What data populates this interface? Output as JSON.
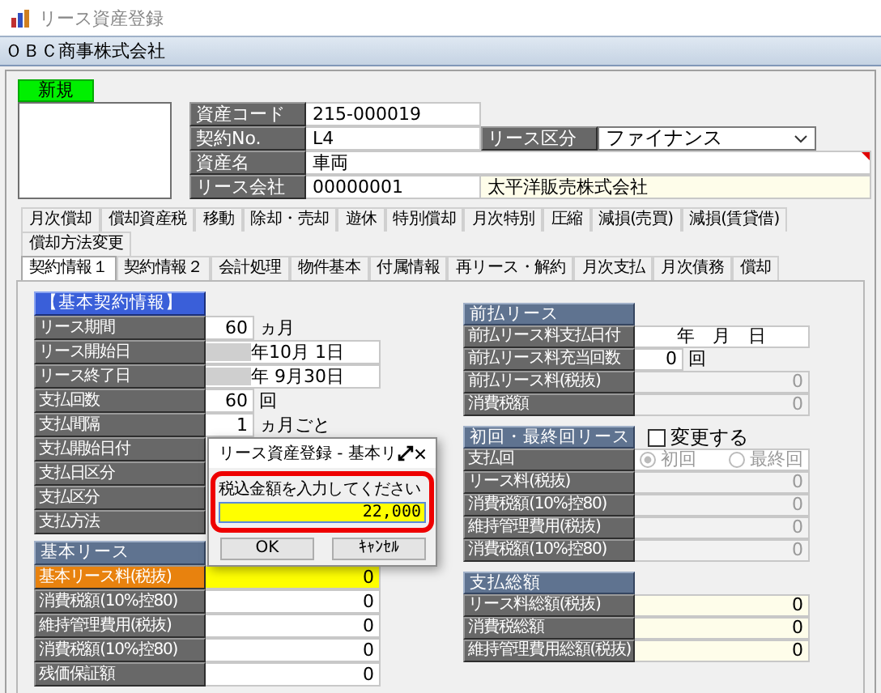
{
  "window": {
    "title": "リース資産登録"
  },
  "company": "ＯＢＣ商事株式会社",
  "mode_badge": "新規",
  "header_rows": [
    [
      {
        "label": "資産コード",
        "value": "215-000019",
        "kind": "text"
      }
    ],
    [
      {
        "label": "契約No.",
        "value": "L4",
        "kind": "text"
      },
      {
        "label": "リース区分",
        "value": "ファイナンス",
        "kind": "select"
      }
    ],
    [
      {
        "label": "資産名",
        "value": "車両",
        "kind": "wide",
        "required": true
      }
    ],
    [
      {
        "label": "リース会社",
        "value": "00000001",
        "kind": "text"
      },
      {
        "value": "太平洋販売株式会社",
        "kind": "name"
      }
    ]
  ],
  "tab_rows": [
    [
      {
        "label": "月次償却",
        "selected": false
      },
      {
        "label": "償却資産税",
        "selected": false
      },
      {
        "label": "移動",
        "selected": false
      },
      {
        "label": "除却・売却",
        "selected": false
      },
      {
        "label": "遊休",
        "selected": false
      },
      {
        "label": "特別償却",
        "selected": false
      },
      {
        "label": "月次特別",
        "selected": false
      },
      {
        "label": "圧縮",
        "selected": false
      },
      {
        "label": "減損(売買)",
        "selected": false
      },
      {
        "label": "減損(賃貸借)",
        "selected": false
      }
    ],
    [
      {
        "label": "償却方法変更",
        "selected": false
      }
    ],
    [
      {
        "label": "契約情報１",
        "selected": true
      },
      {
        "label": "契約情報２",
        "selected": false
      },
      {
        "label": "会計処理",
        "selected": false
      },
      {
        "label": "物件基本",
        "selected": false
      },
      {
        "label": "付属情報",
        "selected": false
      },
      {
        "label": "再リース・解約",
        "selected": false
      },
      {
        "label": "月次支払",
        "selected": false
      },
      {
        "label": "月次債務",
        "selected": false
      },
      {
        "label": "償却",
        "selected": false
      }
    ]
  ],
  "left_sections": [
    {
      "title": "【基本契約情報】",
      "kind": "primary",
      "rows": [
        {
          "label": "リース期間",
          "kind": "count",
          "value": "60",
          "unit": "ヵ月"
        },
        {
          "label": "リース開始日",
          "kind": "date",
          "masked": true,
          "value": "年10月 1日"
        },
        {
          "label": "リース終了日",
          "kind": "date",
          "masked": true,
          "value": "年 9月30日"
        },
        {
          "label": "支払回数",
          "kind": "count",
          "value": "60",
          "unit": "回"
        },
        {
          "label": "支払間隔",
          "kind": "count",
          "value": "1",
          "unit": "ヵ月ごと"
        },
        {
          "label": "支払開始日付",
          "kind": "blank"
        },
        {
          "label": "支払日区分",
          "kind": "blank"
        },
        {
          "label": "支払区分",
          "kind": "blank"
        },
        {
          "label": "支払方法",
          "kind": "blank"
        }
      ]
    },
    {
      "title": "基本リース",
      "kind": "secondary",
      "rows": [
        {
          "label": "基本リース料(税抜)",
          "kind": "amount",
          "value": "0",
          "focused": true,
          "disabled": false,
          "readonly": false
        },
        {
          "label": "消費税額(10%控80)",
          "kind": "amount",
          "value": "0",
          "focused": false,
          "disabled": false,
          "readonly": false
        },
        {
          "label": "維持管理費用(税抜)",
          "kind": "amount",
          "value": "0",
          "focused": false,
          "disabled": false,
          "readonly": false
        },
        {
          "label": "消費税額(10%控80)",
          "kind": "amount",
          "value": "0",
          "focused": false,
          "disabled": false,
          "readonly": false
        },
        {
          "label": "残価保証額",
          "kind": "amount",
          "value": "0",
          "focused": false,
          "disabled": false,
          "readonly": false
        }
      ]
    }
  ],
  "right_sections": [
    {
      "title": "前払リース",
      "kind": "secondary",
      "rows": [
        {
          "label": "前払リース料支払日付",
          "kind": "date",
          "value": "年　月　日"
        },
        {
          "label": "前払リース料充当回数",
          "kind": "count",
          "value": "0",
          "unit": "回"
        },
        {
          "label": "前払リース料(税抜)",
          "kind": "amount",
          "value": "0",
          "focused": false,
          "disabled": true,
          "readonly": false
        },
        {
          "label": "消費税額",
          "kind": "amount",
          "value": "0",
          "focused": false,
          "disabled": true,
          "readonly": false
        }
      ]
    },
    {
      "title": "初回・最終回リース",
      "kind": "secondary",
      "checkbox": {
        "label": "変更する",
        "checked": false
      },
      "rows": [
        {
          "label": "支払回",
          "kind": "radio",
          "disabled": true,
          "options": [
            {
              "label": "初回",
              "selected": true
            },
            {
              "label": "最終回",
              "selected": false
            }
          ]
        },
        {
          "label": "リース料(税抜)",
          "kind": "amount",
          "value": "0",
          "focused": false,
          "disabled": true,
          "readonly": false
        },
        {
          "label": "消費税額(10%控80)",
          "kind": "amount",
          "value": "0",
          "focused": false,
          "disabled": true,
          "readonly": false
        },
        {
          "label": "維持管理費用(税抜)",
          "kind": "amount",
          "value": "0",
          "focused": false,
          "disabled": true,
          "readonly": false
        },
        {
          "label": "消費税額(10%控80)",
          "kind": "amount",
          "value": "0",
          "focused": false,
          "disabled": true,
          "readonly": false
        }
      ]
    },
    {
      "title": "支払総額",
      "kind": "secondary",
      "rows": [
        {
          "label": "リース料総額(税抜)",
          "kind": "amount",
          "value": "0",
          "focused": false,
          "disabled": false,
          "readonly": true
        },
        {
          "label": "消費税総額",
          "kind": "amount",
          "value": "0",
          "focused": false,
          "disabled": false,
          "readonly": true
        },
        {
          "label": "維持管理費用総額(税抜)",
          "kind": "amount",
          "value": "0",
          "focused": false,
          "disabled": false,
          "readonly": true
        }
      ]
    }
  ],
  "dialog": {
    "title": "リース資産登録 - 基本リ",
    "prompt": "税込金額を入力してください",
    "value": "22,000",
    "buttons": [
      "OK",
      "ｷｬﾝｾﾙ"
    ]
  }
}
